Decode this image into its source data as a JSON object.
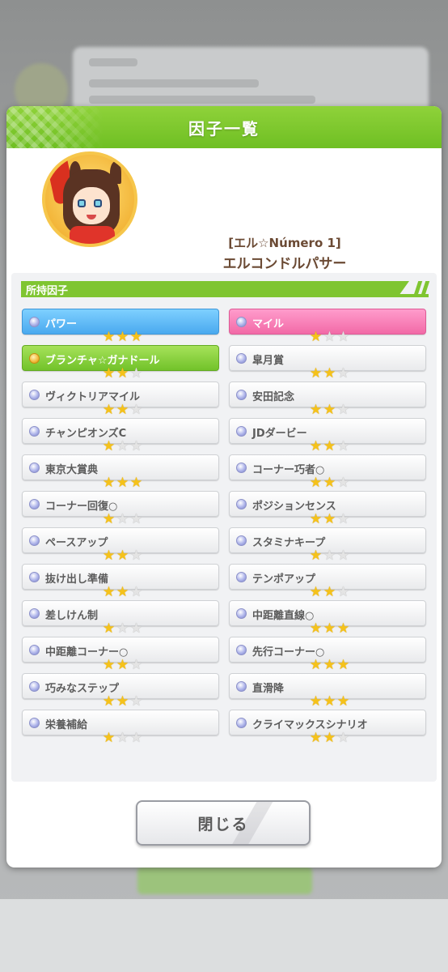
{
  "dialog": {
    "title": "因子一覧"
  },
  "character": {
    "epithet": "[エル☆Número 1]",
    "name": "エルコンドルパサー"
  },
  "section": {
    "label": "所持因子"
  },
  "factors_left": [
    {
      "label": "パワー",
      "stars": 3,
      "style": "blue",
      "dot": "silver"
    },
    {
      "label": "ブランチャ☆ガナドール",
      "stars": 2,
      "style": "green",
      "dot": "gold"
    },
    {
      "label": "ヴィクトリアマイル",
      "stars": 2,
      "style": "white",
      "dot": "silver"
    },
    {
      "label": "チャンピオンズC",
      "stars": 1,
      "style": "white",
      "dot": "silver"
    },
    {
      "label": "東京大賞典",
      "stars": 3,
      "style": "white",
      "dot": "silver"
    },
    {
      "label": "コーナー回復○",
      "stars": 1,
      "style": "white",
      "dot": "silver"
    },
    {
      "label": "ペースアップ",
      "stars": 2,
      "style": "white",
      "dot": "silver"
    },
    {
      "label": "抜け出し準備",
      "stars": 2,
      "style": "white",
      "dot": "silver"
    },
    {
      "label": "差しけん制",
      "stars": 1,
      "style": "white",
      "dot": "silver"
    },
    {
      "label": "中距離コーナー○",
      "stars": 2,
      "style": "white",
      "dot": "silver"
    },
    {
      "label": "巧みなステップ",
      "stars": 2,
      "style": "white",
      "dot": "silver"
    },
    {
      "label": "栄養補給",
      "stars": 1,
      "style": "white",
      "dot": "silver"
    }
  ],
  "factors_right": [
    {
      "label": "マイル",
      "stars": 1,
      "style": "pink",
      "dot": "silver"
    },
    {
      "label": "皐月賞",
      "stars": 2,
      "style": "white",
      "dot": "silver"
    },
    {
      "label": "安田記念",
      "stars": 2,
      "style": "white",
      "dot": "silver"
    },
    {
      "label": "JDダービー",
      "stars": 2,
      "style": "white",
      "dot": "silver"
    },
    {
      "label": "コーナー巧者○",
      "stars": 2,
      "style": "white",
      "dot": "silver"
    },
    {
      "label": "ポジションセンス",
      "stars": 2,
      "style": "white",
      "dot": "silver"
    },
    {
      "label": "スタミナキープ",
      "stars": 1,
      "style": "white",
      "dot": "silver"
    },
    {
      "label": "テンポアップ",
      "stars": 2,
      "style": "white",
      "dot": "silver"
    },
    {
      "label": "中距離直線○",
      "stars": 3,
      "style": "white",
      "dot": "silver"
    },
    {
      "label": "先行コーナー○",
      "stars": 3,
      "style": "white",
      "dot": "silver"
    },
    {
      "label": "直滑降",
      "stars": 3,
      "style": "white",
      "dot": "silver"
    },
    {
      "label": "クライマックスシナリオ",
      "stars": 2,
      "style": "white",
      "dot": "silver"
    }
  ],
  "close_button": {
    "label": "閉じる"
  },
  "colors": {
    "header_green": "#7fc531",
    "skill_blue": "#4aa9ef",
    "skill_pink": "#f26aa7",
    "unique_green": "#72c22a",
    "star_on": "#f5c21a"
  }
}
